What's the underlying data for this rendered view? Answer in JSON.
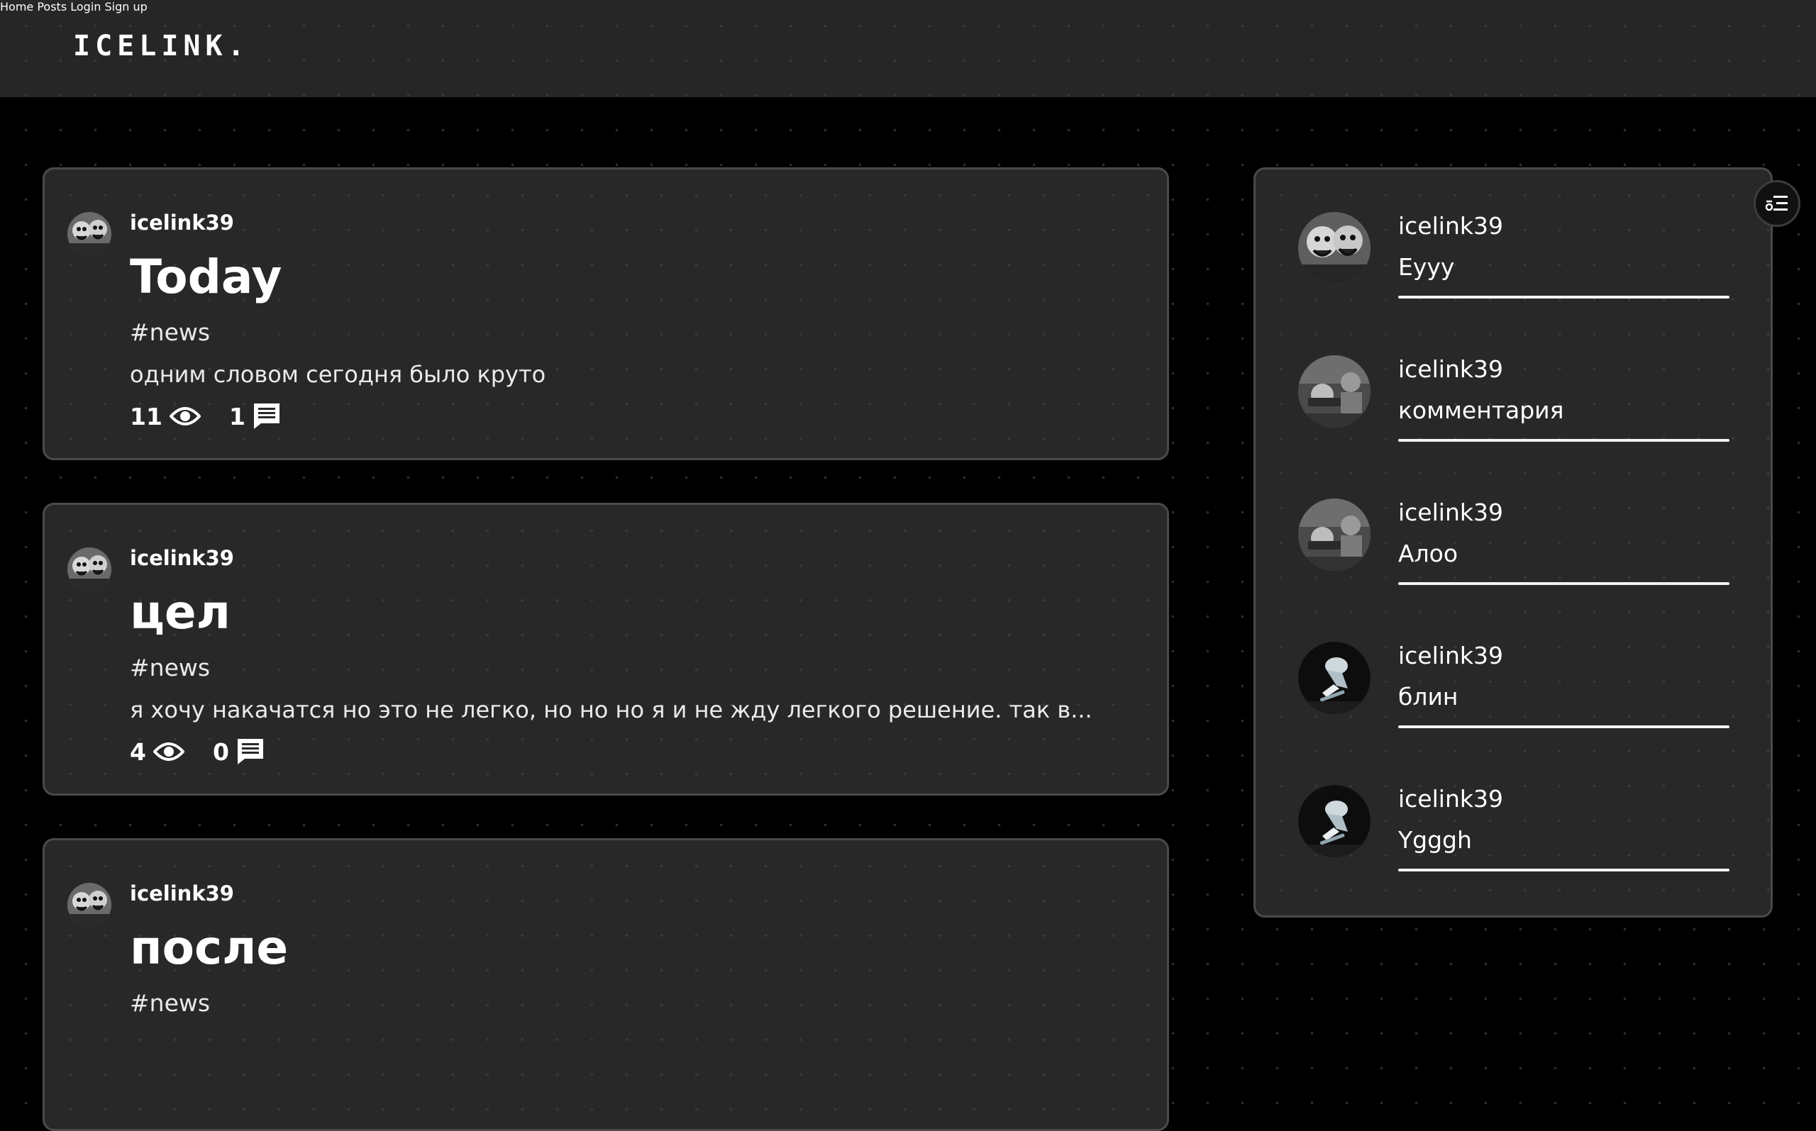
{
  "header": {
    "logo": "ICELINK.",
    "nav": [
      {
        "label": "Home"
      },
      {
        "label": "Posts"
      },
      {
        "label": "Login"
      },
      {
        "label": "Sign up"
      }
    ]
  },
  "posts": [
    {
      "author": "icelink39",
      "title": "Today",
      "tag": "#news",
      "text": "одним словом сегодня было круто",
      "views": "11",
      "comments": "1"
    },
    {
      "author": "icelink39",
      "title": "цел",
      "tag": "#news",
      "text": "я хочу накачатся но это не легко, но но но я и не жду легкого решение. так в...",
      "views": "4",
      "comments": "0"
    },
    {
      "author": "icelink39",
      "title": "после",
      "tag": "#news",
      "text": "",
      "views": "",
      "comments": ""
    }
  ],
  "comments": [
    {
      "author": "icelink39",
      "text": "Eyyy"
    },
    {
      "author": "icelink39",
      "text": "комментария"
    },
    {
      "author": "icelink39",
      "text": "Алоо"
    },
    {
      "author": "icelink39",
      "text": "блин"
    },
    {
      "author": "icelink39",
      "text": "Ygggh"
    }
  ],
  "icons": {
    "views": "eye-icon",
    "comments": "comment-icon",
    "floating": "filter-icon"
  },
  "colors": {
    "background": "#000000",
    "header": "#262626",
    "card": "#282828",
    "card_border": "#4a4a4a",
    "text": "#ffffff"
  }
}
